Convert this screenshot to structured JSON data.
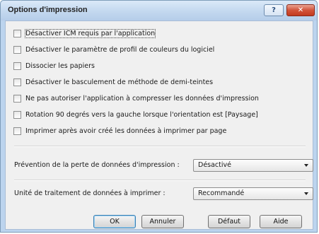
{
  "window": {
    "title": "Options d'impression",
    "help_glyph": "?",
    "close_glyph": "✕"
  },
  "options": [
    {
      "label": "Désactiver ICM requis par l'application",
      "checked": false
    },
    {
      "label": "Désactiver le paramètre de profil de couleurs du logiciel",
      "checked": false
    },
    {
      "label": "Dissocier les papiers",
      "checked": false
    },
    {
      "label": "Désactiver le basculement de méthode de demi-teintes",
      "checked": false
    },
    {
      "label": "Ne pas autoriser l'application à compresser les données d'impression",
      "checked": false
    },
    {
      "label": "Rotation 90 degrés vers la gauche lorsque l'orientation est [Paysage]",
      "checked": false
    },
    {
      "label": "Imprimer après avoir créé les données à imprimer par page",
      "checked": false
    }
  ],
  "fields": {
    "prevention_label": "Prévention de la perte de données d'impression :",
    "prevention_value": "Désactivé",
    "unit_label": "Unité de traitement de données à imprimer :",
    "unit_value": "Recommandé"
  },
  "buttons": {
    "ok": "OK",
    "cancel": "Annuler",
    "default": "Défaut",
    "help": "Aide"
  }
}
